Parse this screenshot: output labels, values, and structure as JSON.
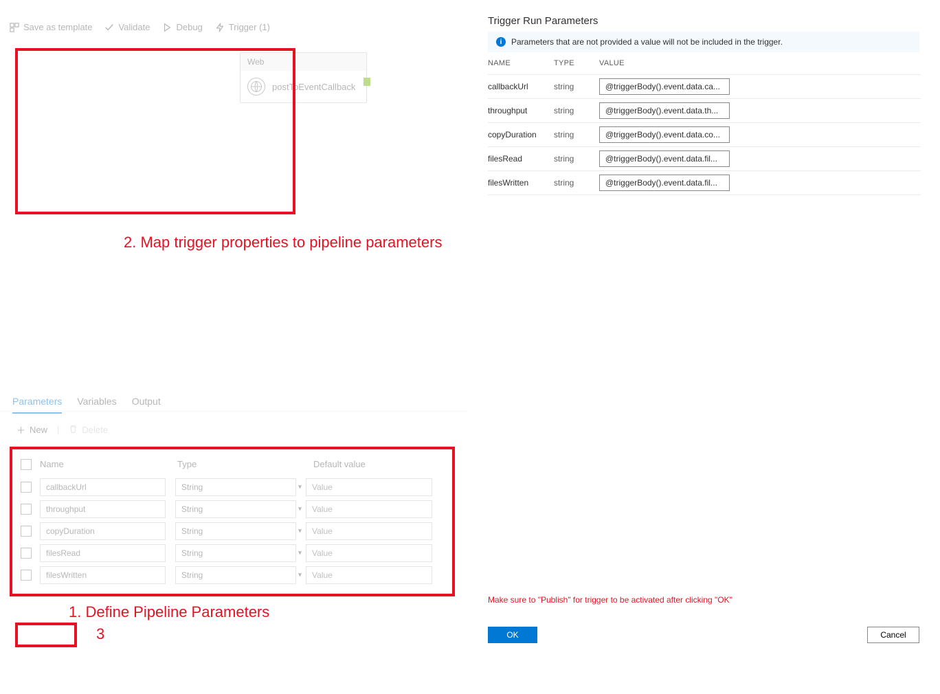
{
  "toolbar": {
    "save_template": "Save as template",
    "validate": "Validate",
    "debug": "Debug",
    "trigger": "Trigger (1)"
  },
  "activity": {
    "type": "Web",
    "name": "postToEventCallback"
  },
  "tabs": {
    "parameters": "Parameters",
    "variables": "Variables",
    "output": "Output"
  },
  "subbar": {
    "new": "New",
    "delete": "Delete"
  },
  "param_headers": {
    "name": "Name",
    "type": "Type",
    "default": "Default value"
  },
  "param_rows": [
    {
      "name": "callbackUrl",
      "type": "String",
      "default_ph": "Value"
    },
    {
      "name": "throughput",
      "type": "String",
      "default_ph": "Value"
    },
    {
      "name": "copyDuration",
      "type": "String",
      "default_ph": "Value"
    },
    {
      "name": "filesRead",
      "type": "String",
      "default_ph": "Value"
    },
    {
      "name": "filesWritten",
      "type": "String",
      "default_ph": "Value"
    }
  ],
  "annotations": {
    "left": "1. Define Pipeline Parameters",
    "right": "2. Map trigger properties to pipeline parameters",
    "three": "3"
  },
  "right_panel": {
    "title": "Trigger Run Parameters",
    "info": "Parameters that are not provided a value will not be included in the trigger.",
    "headers": {
      "name": "NAME",
      "type": "TYPE",
      "value": "VALUE"
    },
    "rows": [
      {
        "name": "callbackUrl",
        "type": "string",
        "value": "@triggerBody().event.data.ca..."
      },
      {
        "name": "throughput",
        "type": "string",
        "value": "@triggerBody().event.data.th..."
      },
      {
        "name": "copyDuration",
        "type": "string",
        "value": "@triggerBody().event.data.co..."
      },
      {
        "name": "filesRead",
        "type": "string",
        "value": "@triggerBody().event.data.fil..."
      },
      {
        "name": "filesWritten",
        "type": "string",
        "value": "@triggerBody().event.data.fil..."
      }
    ],
    "publish_note": "Make sure to \"Publish\" for trigger to be activated after clicking \"OK\"",
    "ok": "OK",
    "cancel": "Cancel"
  }
}
